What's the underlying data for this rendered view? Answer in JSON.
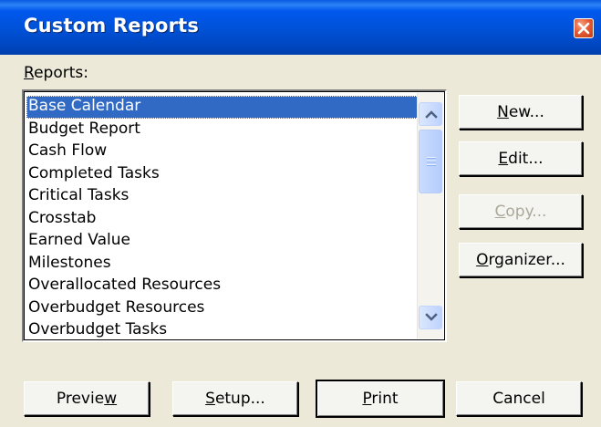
{
  "window": {
    "title": "Custom Reports"
  },
  "reports_label": {
    "pre": "",
    "accel": "R",
    "post": "eports:"
  },
  "reports": {
    "selected_index": 0,
    "items": [
      "Base Calendar",
      "Budget Report",
      "Cash Flow",
      "Completed Tasks",
      "Critical Tasks",
      "Crosstab",
      "Earned Value",
      "Milestones",
      "Overallocated Resources",
      "Overbudget Resources",
      "Overbudget Tasks"
    ]
  },
  "side_buttons": {
    "new": {
      "pre": "",
      "accel": "N",
      "post": "ew..."
    },
    "edit": {
      "pre": "",
      "accel": "E",
      "post": "dit..."
    },
    "copy": {
      "pre": "",
      "accel": "C",
      "post": "opy..."
    },
    "organizer": {
      "pre": "",
      "accel": "O",
      "post": "rganizer..."
    }
  },
  "bottom_buttons": {
    "preview": {
      "pre": "Previe",
      "accel": "w",
      "post": ""
    },
    "setup": {
      "pre": "",
      "accel": "S",
      "post": "etup..."
    },
    "print": {
      "pre": "",
      "accel": "P",
      "post": "rint"
    },
    "cancel": {
      "pre": "Cancel",
      "accel": "",
      "post": ""
    }
  },
  "icons": {
    "close": "close-icon",
    "scroll_up": "chevron-up-icon",
    "scroll_down": "chevron-down-icon"
  }
}
